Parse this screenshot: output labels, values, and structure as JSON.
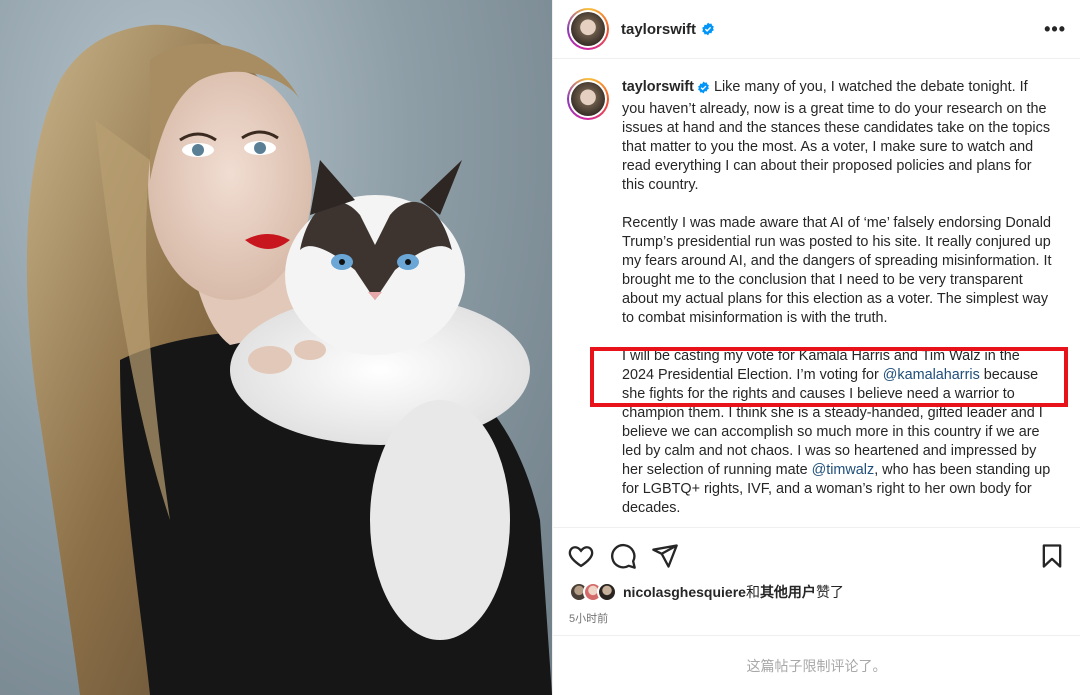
{
  "post": {
    "username": "taylorswift",
    "more_label": "•••",
    "caption_paragraphs": [
      "Like many of you, I watched the debate tonight. If you haven’t already, now is a great time to do your research on the issues at hand and the stances these candidates take on the topics that matter to you the most. As a voter, I make sure to watch and read everything I can about their proposed policies and plans for this country.",
      "Recently I was made aware that AI of ‘me’ falsely endorsing Donald Trump’s presidential run was posted to his site. It really conjured up my fears around AI, and the dangers of spreading misinformation. It brought me to the conclusion that I need to be very transparent about my actual plans for this election as a voter. The simplest way to combat misinformation is with the truth."
    ],
    "p3_part1": "I will be casting my vote for Kamala Harris and Tim Walz in the 2024 Presidential Election. I’m voting for ",
    "mention_kamala": "@kamalaharris",
    "p3_part2": " because she fights for the rights and causes I believe need a warrior to champion them. I think she is a steady-handed, gifted leader and I believe we can accomplish so much more in this country if we are led by calm and not chaos. I was so heartened and impressed by her selection of running mate ",
    "mention_walz": "@timwalz",
    "p3_part3": ", who has been standing up for LGBTQ+ rights, IVF, and a woman’s right to her own body for decades."
  },
  "actions": {
    "like_icon": "heart-icon",
    "comment_icon": "comment-icon",
    "share_icon": "send-icon",
    "save_icon": "bookmark-icon"
  },
  "likes": {
    "first_liker": "nicolasghesquiere",
    "connector": "和",
    "others": "其他用户",
    "suffix": "赞了"
  },
  "timestamp": "5小时前",
  "comments_limited": "这篇帖子限制评论了。",
  "colors": {
    "highlight_border": "#e8121a",
    "mention": "#1f4e79",
    "verified": "#0095f6"
  }
}
